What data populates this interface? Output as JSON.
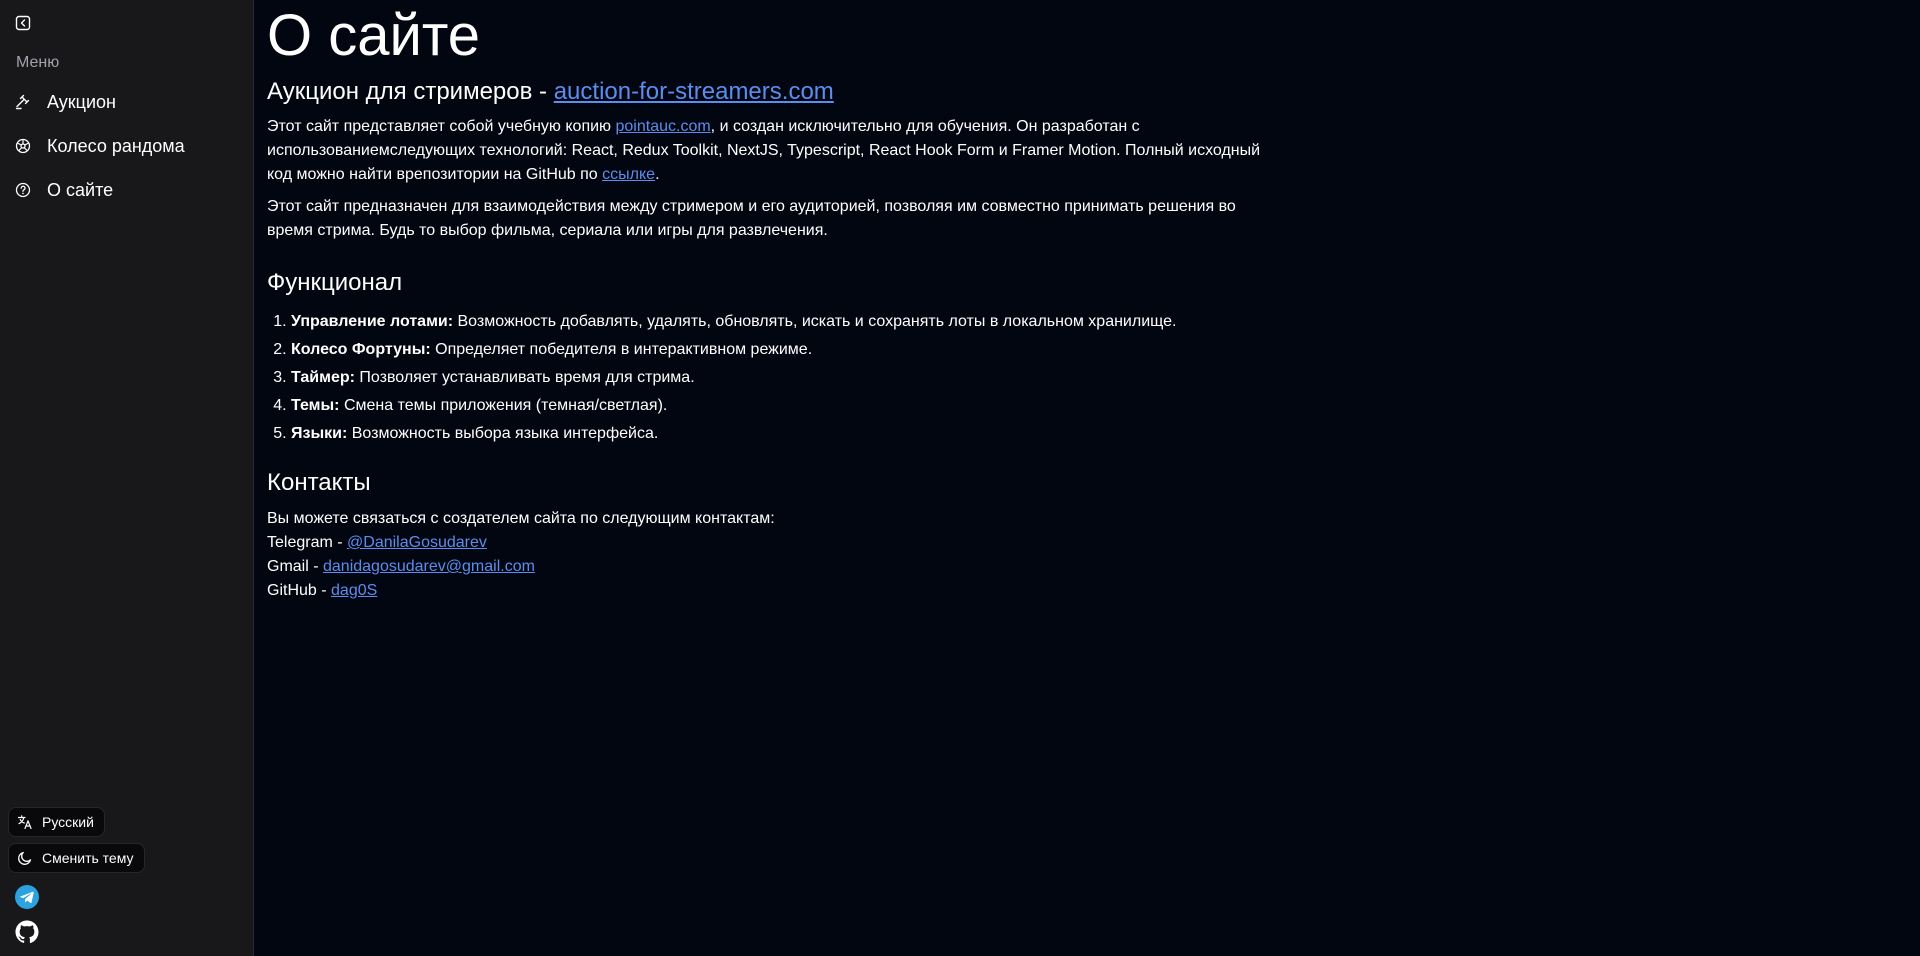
{
  "sidebar": {
    "menu_label": "Меню",
    "items": [
      {
        "label": "Аукцион",
        "icon": "gavel-icon"
      },
      {
        "label": "Колесо рандома",
        "icon": "wheel-icon"
      },
      {
        "label": "О сайте",
        "icon": "help-circle-icon"
      }
    ],
    "language_label": "Русский",
    "theme_label": "Сменить тему"
  },
  "main": {
    "title": "О сайте",
    "subtitle_prefix": "Аукцион для стримеров - ",
    "subtitle_link": "auction-for-streamers.com",
    "intro": {
      "part1": "Этот сайт представляет собой учебную копию ",
      "link1": "pointauc.com",
      "part2": ", и создан исключительно для обучения. Он разработан с использованиемследующих технологий: React, Redux Toolkit, NextJS, Typescript, React Hook Form и Framer Motion. Полный исходный код можно найти врепозитории на GitHub по ",
      "link2": "ссылке",
      "part3": "."
    },
    "purpose": "Этот сайт предназначен для взаимодействия между стримером и его аудиторией, позволяя им совместно принимать решения во время стрима. Будь то выбор фильма, сериала или игры для развлечения.",
    "features_title": "Функционал",
    "features": [
      {
        "name": "Управление лотами:",
        "text": " Возможность добавлять, удалять, обновлять, искать и сохранять лоты в локальном хранилище."
      },
      {
        "name": "Колесо Фортуны:",
        "text": " Определяет победителя в интерактивном режиме."
      },
      {
        "name": "Таймер:",
        "text": " Позволяет устанавливать время для стрима."
      },
      {
        "name": "Темы:",
        "text": " Смена темы приложения (темная/светлая)."
      },
      {
        "name": "Языки:",
        "text": " Возможность выбора языка интерфейса."
      }
    ],
    "contacts_title": "Контакты",
    "contacts_intro": "Вы можете связаться с создателем сайта по следующим контактам:",
    "contacts": [
      {
        "label": "Telegram - ",
        "value": "@DanilaGosudarev"
      },
      {
        "label": "Gmail - ",
        "value": "danidagosudarev@gmail.com"
      },
      {
        "label": "GitHub - ",
        "value": "dag0S"
      }
    ]
  },
  "colors": {
    "background": "#020611",
    "sidebar": "#18181b",
    "link": "#5b8def",
    "telegram": "#2aa3df"
  }
}
